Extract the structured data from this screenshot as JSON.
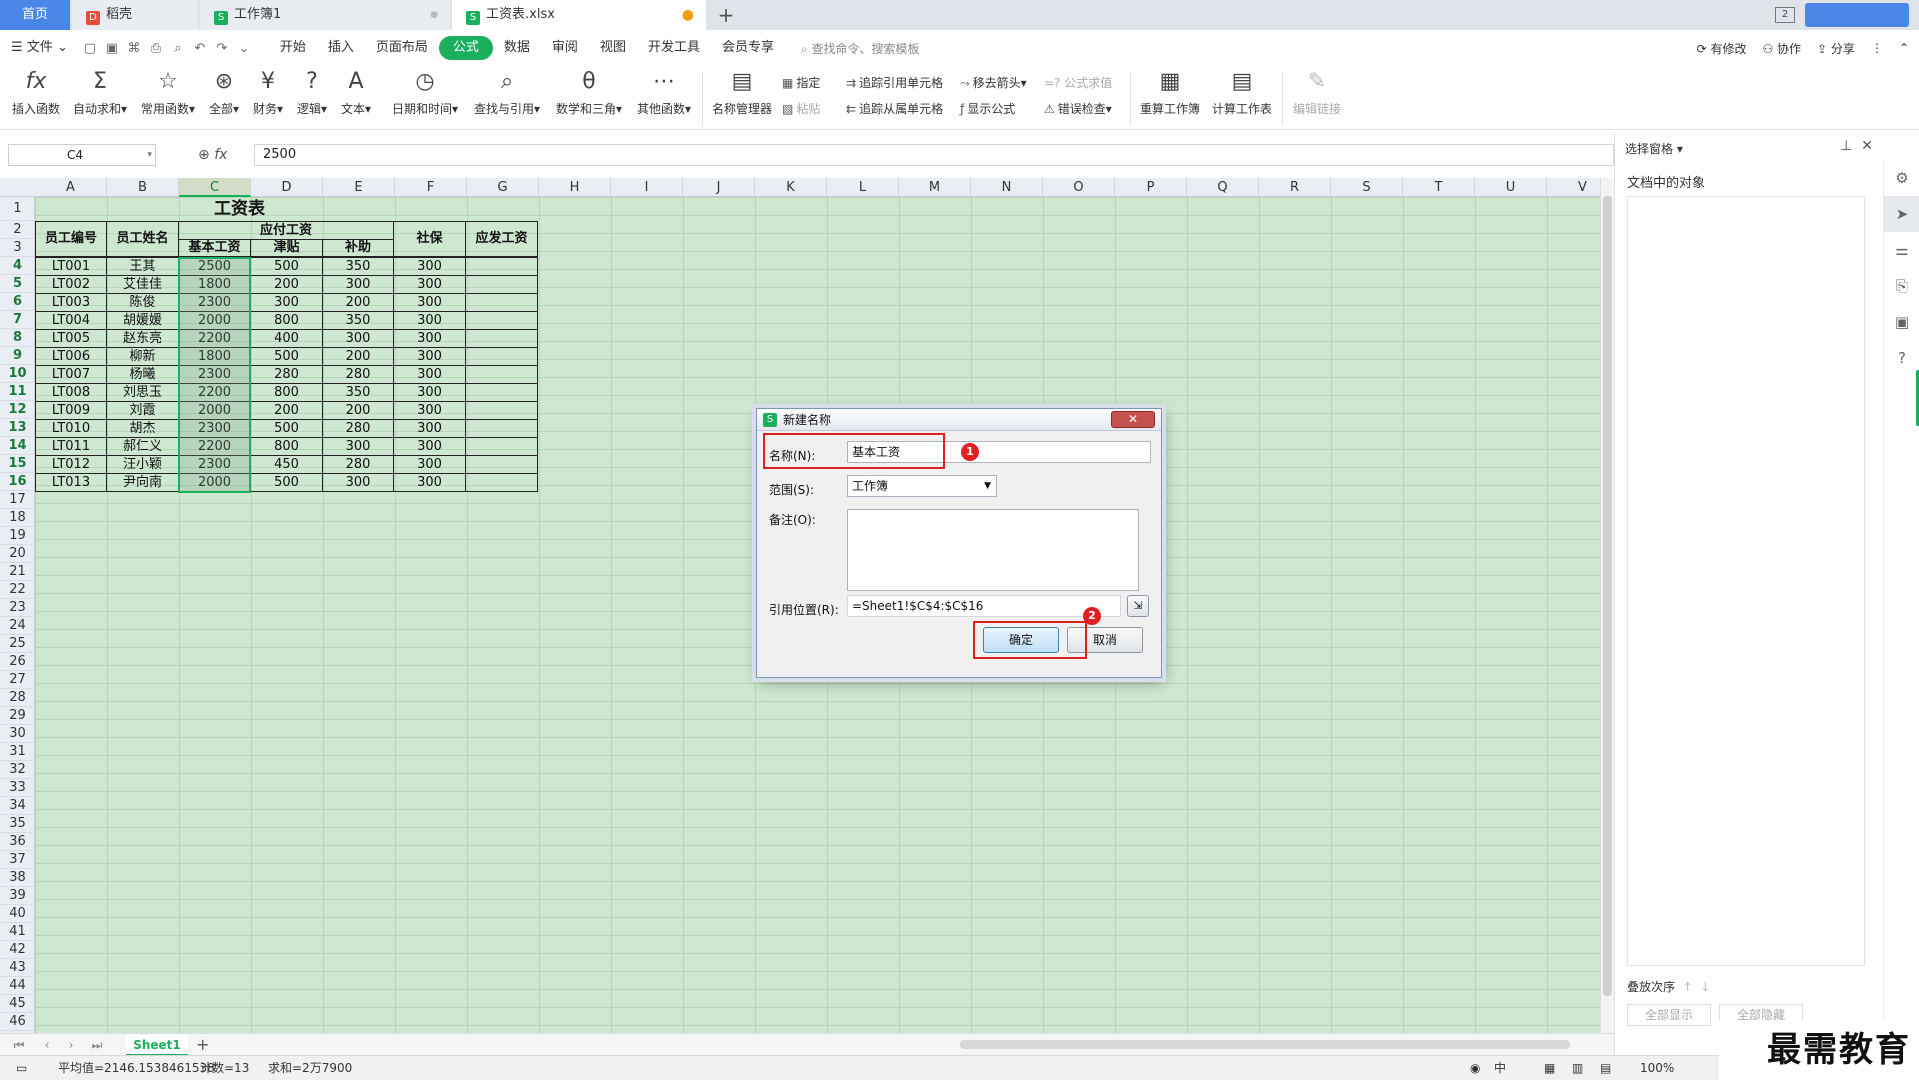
{
  "tabs": {
    "home": "首页",
    "docer": "稻壳",
    "workbook1": "工作簿1",
    "active": "工资表.xlsx",
    "new_tab_symbol": "+",
    "close_symbol": "●",
    "modified_symbol": "●"
  },
  "window_controls": {
    "layout_badge": "2"
  },
  "menu": {
    "file": "文件",
    "items": [
      "开始",
      "插入",
      "页面布局",
      "公式",
      "数据",
      "审阅",
      "视图",
      "开发工具",
      "会员专享"
    ],
    "active": "公式",
    "search_placeholder": "查找命令、搜索模板",
    "right": {
      "modified": "有修改",
      "collab": "协作",
      "share": "分享"
    }
  },
  "ribbon": {
    "insert_function": "插入函数",
    "autosum": "自动求和",
    "common_functions": "常用函数",
    "all": "全部",
    "finance": "财务",
    "logic": "逻辑",
    "text": "文本",
    "datetime": "日期和时间",
    "lookup": "查找与引用",
    "math": "数学和三角",
    "other": "其他函数",
    "name_manager": "名称管理器",
    "define": "指定",
    "paste": "粘贴",
    "trace_precedents": "追踪引用单元格",
    "trace_dependents": "追踪从属单元格",
    "remove_arrows": "移去箭头",
    "show_formulas": "显示公式",
    "evaluate": "=? 公式求值",
    "error_check": "错误检查",
    "recalc_workbook": "重算工作簿",
    "calc_sheet": "计算工作表",
    "edit_links": "编辑链接"
  },
  "formula_bar": {
    "name_box": "C4",
    "fx": "fx",
    "value": "2500"
  },
  "columns": [
    "A",
    "B",
    "C",
    "D",
    "E",
    "F",
    "G",
    "H",
    "I",
    "J",
    "K",
    "L",
    "M",
    "N",
    "O",
    "P",
    "Q",
    "R",
    "S",
    "T",
    "U",
    "V"
  ],
  "selected_column": "C",
  "row_count": 46,
  "table": {
    "title": "工资表",
    "headers": {
      "id": "员工编号",
      "name": "员工姓名",
      "payable": "应付工资",
      "base": "基本工资",
      "allowance": "津贴",
      "subsidy": "补助",
      "social": "社保",
      "net": "应发工资"
    },
    "rows": [
      [
        "LT001",
        "王其",
        "2500",
        "500",
        "350",
        "300"
      ],
      [
        "LT002",
        "艾佳佳",
        "1800",
        "200",
        "300",
        "300"
      ],
      [
        "LT003",
        "陈俊",
        "2300",
        "300",
        "200",
        "300"
      ],
      [
        "LT004",
        "胡媛媛",
        "2000",
        "800",
        "350",
        "300"
      ],
      [
        "LT005",
        "赵东亮",
        "2200",
        "400",
        "300",
        "300"
      ],
      [
        "LT006",
        "柳新",
        "1800",
        "500",
        "200",
        "300"
      ],
      [
        "LT007",
        "杨曦",
        "2300",
        "280",
        "280",
        "300"
      ],
      [
        "LT008",
        "刘思玉",
        "2200",
        "800",
        "350",
        "300"
      ],
      [
        "LT009",
        "刘霞",
        "2000",
        "200",
        "200",
        "300"
      ],
      [
        "LT010",
        "胡杰",
        "2300",
        "500",
        "280",
        "300"
      ],
      [
        "LT011",
        "郝仁义",
        "2200",
        "800",
        "300",
        "300"
      ],
      [
        "LT012",
        "汪小颖",
        "2300",
        "450",
        "280",
        "300"
      ],
      [
        "LT013",
        "尹向南",
        "2000",
        "500",
        "300",
        "300"
      ]
    ]
  },
  "dialog": {
    "title": "新建名称",
    "close_symbol": "✕",
    "name_label": "名称(N):",
    "name_value": "基本工资",
    "scope_label": "范围(S):",
    "scope_value": "工作簿",
    "comment_label": "备注(O):",
    "ref_label": "引用位置(R):",
    "ref_value": "=Sheet1!$C$4:$C$16",
    "ok": "确定",
    "cancel": "取消",
    "marker1": "1",
    "marker2": "2"
  },
  "selection_pane": {
    "title": "选择窗格",
    "subtitle": "文档中的对象",
    "order_label": "叠放次序",
    "show_all": "全部显示",
    "hide_all": "全部隐藏"
  },
  "sheet_tabs": {
    "sheet1": "Sheet1",
    "add": "+"
  },
  "status": {
    "average": "平均值=2146.1538461538",
    "count": "计数=13",
    "sum": "求和=2万7900",
    "input_mode": "中",
    "zoom": "100%"
  },
  "brand": "最需教育"
}
